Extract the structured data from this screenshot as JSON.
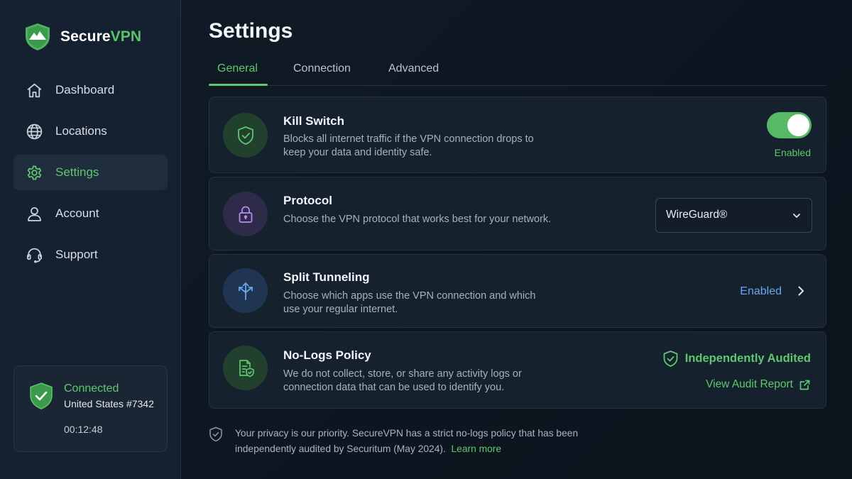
{
  "brand": {
    "name_part1": "Secure",
    "name_part2": "VPN",
    "accent": "#58c468"
  },
  "sidebar": {
    "items": [
      {
        "label": "Dashboard",
        "icon": "home-icon",
        "active": false
      },
      {
        "label": "Locations",
        "icon": "globe-icon",
        "active": false
      },
      {
        "label": "Settings",
        "icon": "gear-icon",
        "active": true
      },
      {
        "label": "Account",
        "icon": "user-icon",
        "active": false
      },
      {
        "label": "Support",
        "icon": "headset-icon",
        "active": false
      }
    ]
  },
  "status": {
    "state": "Connected",
    "server": "United States #7342",
    "duration": "00:12:48"
  },
  "page": {
    "title": "Settings"
  },
  "tabs": [
    {
      "label": "General",
      "active": true
    },
    {
      "label": "Connection",
      "active": false
    },
    {
      "label": "Advanced",
      "active": false
    }
  ],
  "settings": {
    "kill_switch": {
      "title": "Kill Switch",
      "description": "Blocks all internet traffic if the VPN connection drops to keep your data and identity safe.",
      "toggle_on": true,
      "state_label": "Enabled"
    },
    "protocol": {
      "title": "Protocol",
      "description": "Choose the VPN protocol that works best for your network.",
      "selected": "WireGuard®"
    },
    "split_tunneling": {
      "title": "Split Tunneling",
      "description": "Choose which apps use the VPN connection and which use your regular internet.",
      "state_label": "Enabled"
    },
    "no_logs": {
      "title": "No-Logs Policy",
      "description": "We do not collect, store, or share any activity logs or connection data that can be used to identify you.",
      "badge": "Independently Audited",
      "link_label": "View Audit Report"
    }
  },
  "footer": {
    "text": "Your privacy is our priority. SecureVPN has a strict no-logs policy that has been independently audited by Securitum (May 2024).",
    "link_label": "Learn more"
  },
  "colors": {
    "green": "#5fc76d",
    "blue": "#6aa6f0",
    "purple": "#b88af0",
    "background": "#0e1722"
  }
}
